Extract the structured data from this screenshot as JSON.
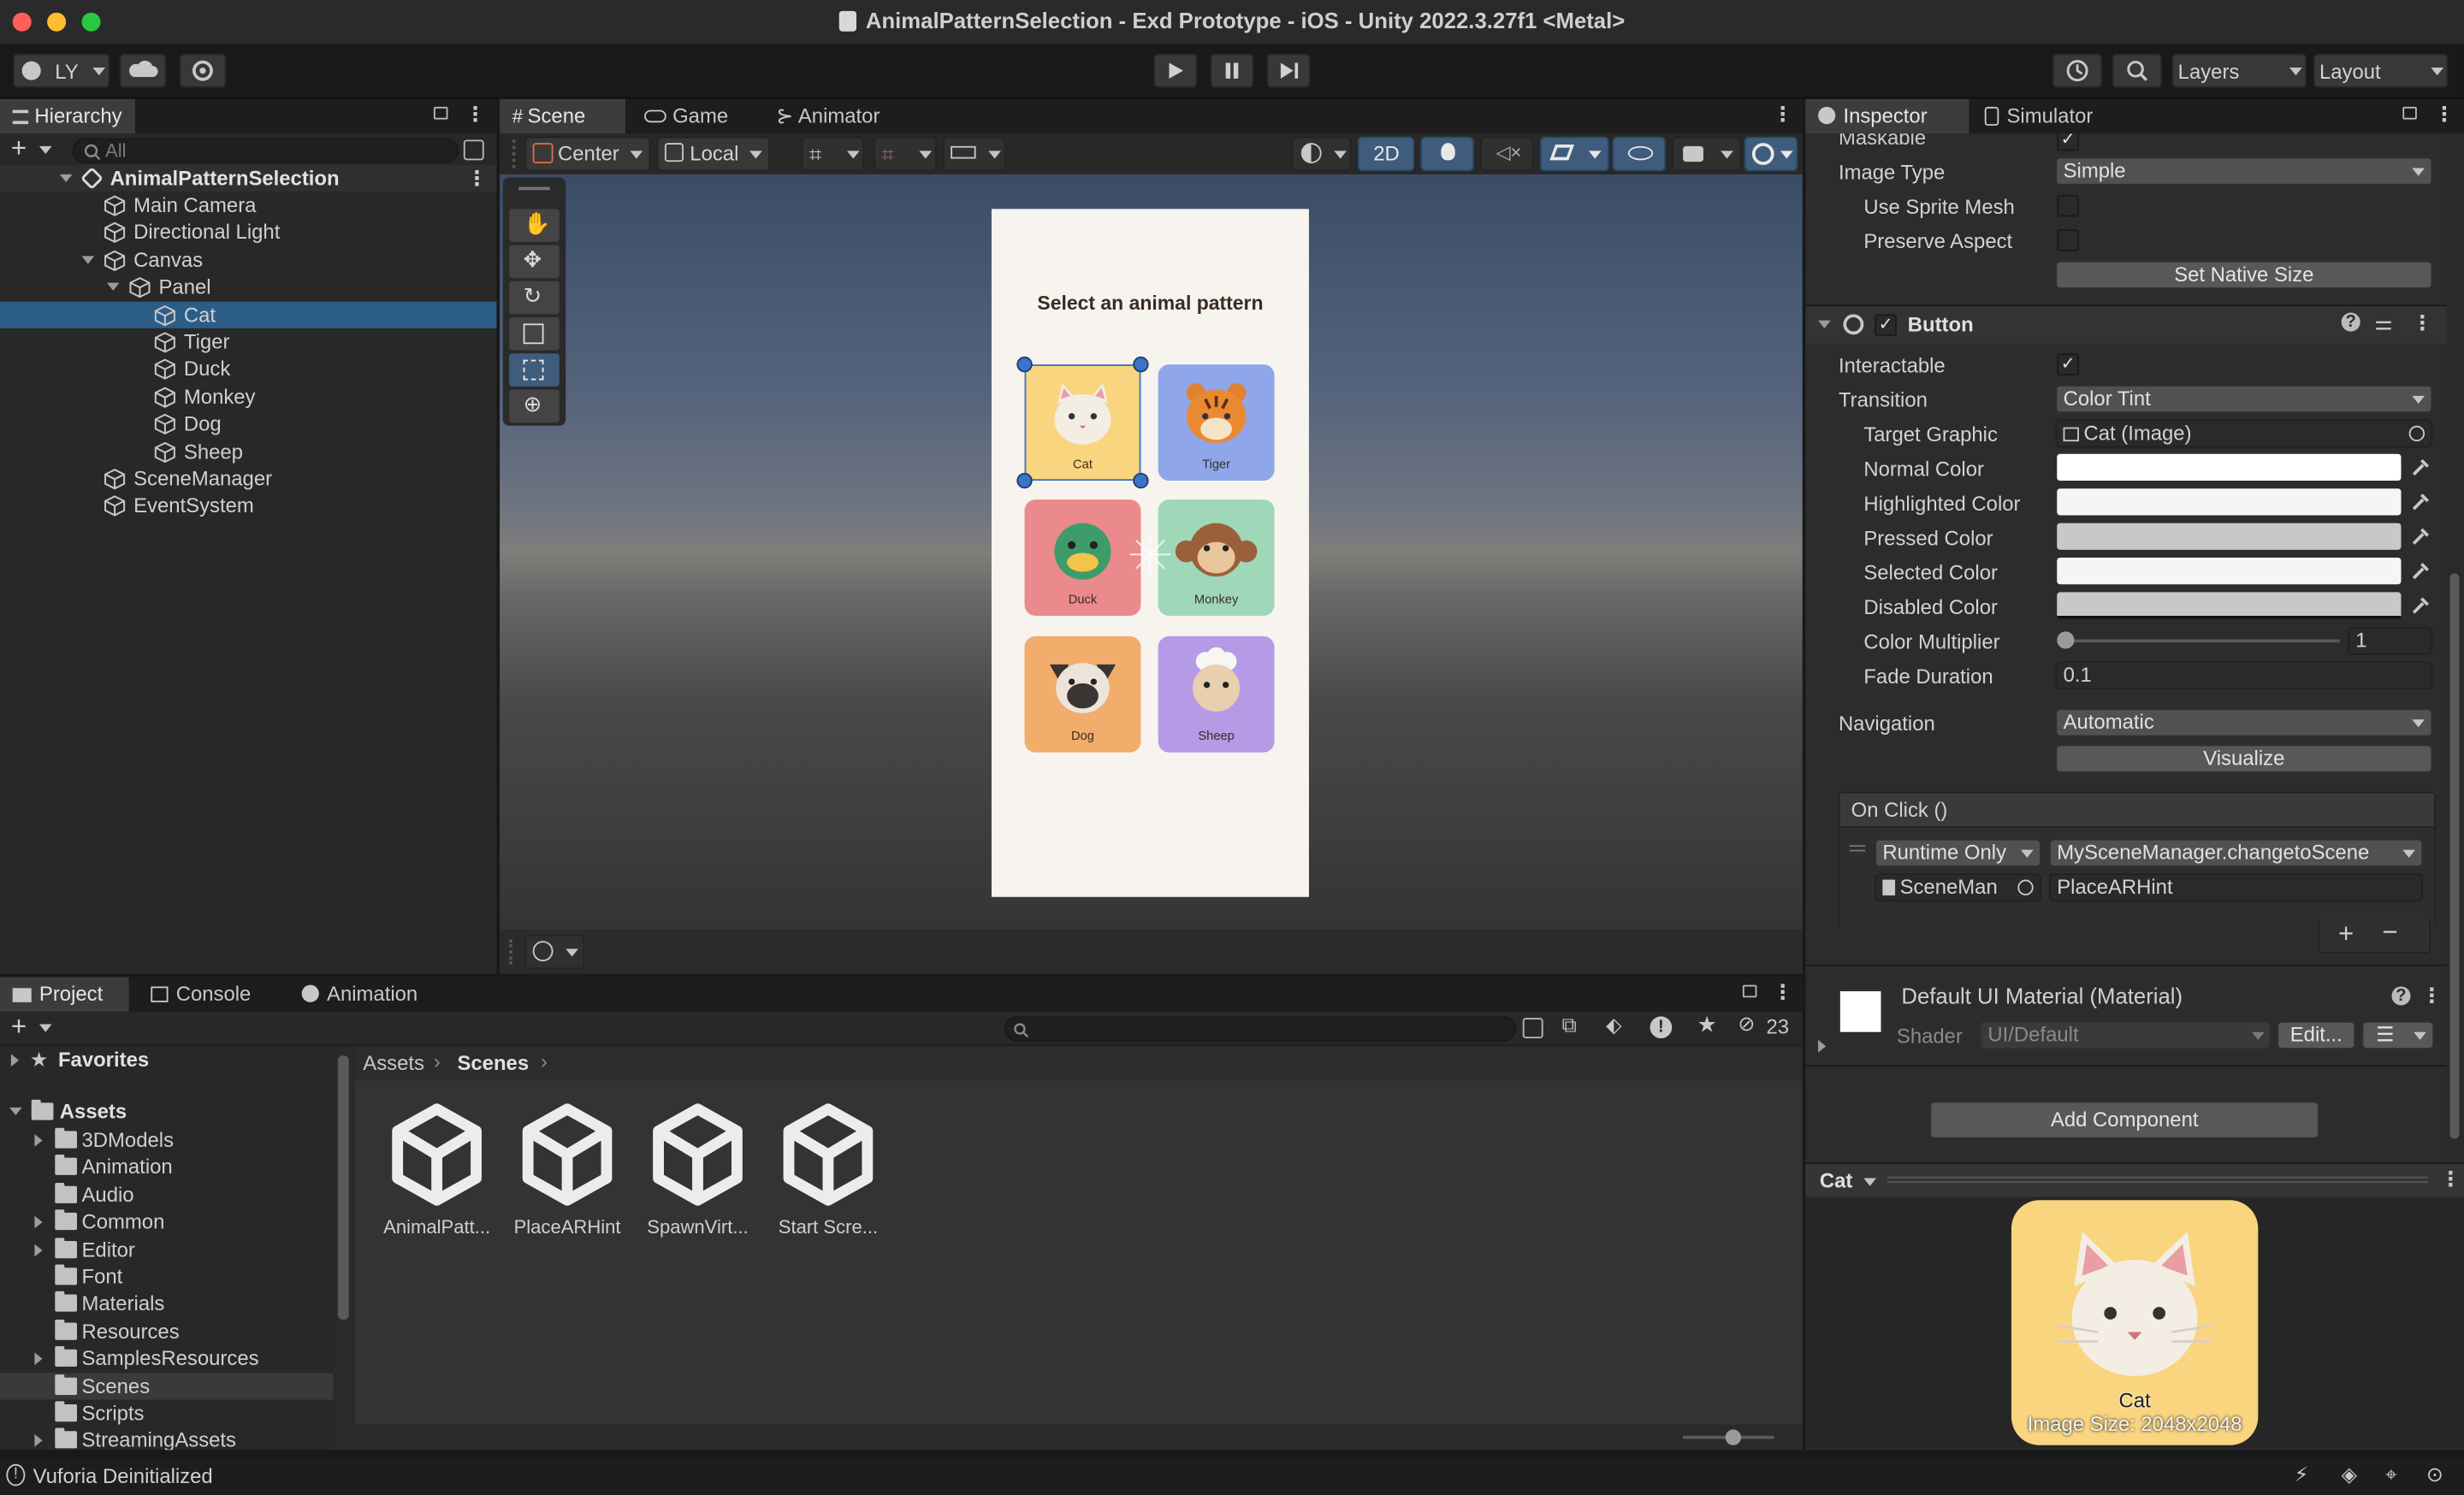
{
  "window": {
    "title": "AnimalPatternSelection - Exd Prototype - iOS - Unity 2022.3.27f1 <Metal>"
  },
  "toolbar": {
    "account_label": "LY",
    "layers_label": "Layers",
    "layout_label": "Layout"
  },
  "hierarchy": {
    "tab_label": "Hierarchy",
    "search_placeholder": "All",
    "scene_name": "AnimalPatternSelection",
    "items": [
      {
        "label": "Main Camera",
        "depth": 1
      },
      {
        "label": "Directional Light",
        "depth": 1
      },
      {
        "label": "Canvas",
        "depth": 1
      },
      {
        "label": "Panel",
        "depth": 2
      },
      {
        "label": "Cat",
        "depth": 3
      },
      {
        "label": "Tiger",
        "depth": 3
      },
      {
        "label": "Duck",
        "depth": 3
      },
      {
        "label": "Monkey",
        "depth": 3
      },
      {
        "label": "Dog",
        "depth": 3
      },
      {
        "label": "Sheep",
        "depth": 3
      },
      {
        "label": "SceneManager",
        "depth": 1
      },
      {
        "label": "EventSystem",
        "depth": 1
      }
    ]
  },
  "scene_view": {
    "tabs": [
      "Scene",
      "Game",
      "Animator"
    ],
    "pivot_label": "Center",
    "space_label": "Local",
    "mode_2d_label": "2D",
    "canvas_title": "Select an animal pattern",
    "cards": [
      {
        "label": "Cat",
        "color": "#f8d57e"
      },
      {
        "label": "Tiger",
        "color": "#8fa7ea"
      },
      {
        "label": "Duck",
        "color": "#ea8a8c"
      },
      {
        "label": "Monkey",
        "color": "#9fd8b8"
      },
      {
        "label": "Dog",
        "color": "#f2ac6c"
      },
      {
        "label": "Sheep",
        "color": "#b59ae6"
      }
    ]
  },
  "inspector": {
    "tabs": [
      "Inspector",
      "Simulator"
    ],
    "maskable_label": "Maskable",
    "image_type_label": "Image Type",
    "image_type_value": "Simple",
    "use_sprite_mesh_label": "Use Sprite Mesh",
    "preserve_aspect_label": "Preserve Aspect",
    "set_native_size_label": "Set Native Size",
    "button_component_label": "Button",
    "interactable_label": "Interactable",
    "transition_label": "Transition",
    "transition_value": "Color Tint",
    "target_graphic_label": "Target Graphic",
    "target_graphic_value": "Cat (Image)",
    "normal_color_label": "Normal Color",
    "highlighted_color_label": "Highlighted Color",
    "pressed_color_label": "Pressed Color",
    "selected_color_label": "Selected Color",
    "disabled_color_label": "Disabled Color",
    "color_multiplier_label": "Color Multiplier",
    "color_multiplier_value": "1",
    "fade_duration_label": "Fade Duration",
    "fade_duration_value": "0.1",
    "navigation_label": "Navigation",
    "navigation_value": "Automatic",
    "visualize_label": "Visualize",
    "onclick_label": "On Click ()",
    "runtime_value": "Runtime Only",
    "function_value": "MySceneManager.changetoScene",
    "object_value": "SceneMan",
    "argument_value": "PlaceARHint",
    "material_name": "Default UI Material (Material)",
    "shader_label": "Shader",
    "shader_value": "UI/Default",
    "edit_label": "Edit...",
    "add_component_label": "Add Component",
    "preview_name": "Cat",
    "preview_caption": "Cat",
    "preview_size": "Image Size: 2048x2048"
  },
  "project": {
    "tabs": [
      "Project",
      "Console",
      "Animation"
    ],
    "favorites_label": "Favorites",
    "assets_label": "Assets",
    "folders": [
      {
        "label": "3DModels",
        "expandable": true
      },
      {
        "label": "Animation",
        "expandable": false
      },
      {
        "label": "Audio",
        "expandable": false
      },
      {
        "label": "Common",
        "expandable": true
      },
      {
        "label": "Editor",
        "expandable": true
      },
      {
        "label": "Font",
        "expandable": false
      },
      {
        "label": "Materials",
        "expandable": false
      },
      {
        "label": "Resources",
        "expandable": false
      },
      {
        "label": "SamplesResources",
        "expandable": true
      },
      {
        "label": "Scenes",
        "expandable": false
      },
      {
        "label": "Scripts",
        "expandable": false
      },
      {
        "label": "StreamingAssets",
        "expandable": true
      }
    ],
    "breadcrumb_root": "Assets",
    "breadcrumb_current": "Scenes",
    "hidden_count": "23",
    "assets": [
      {
        "label": "AnimalPatt..."
      },
      {
        "label": "PlaceARHint"
      },
      {
        "label": "SpawnVirt..."
      },
      {
        "label": "Start Scre..."
      }
    ]
  },
  "status_bar": {
    "message": "Vuforia Deinitialized"
  }
}
